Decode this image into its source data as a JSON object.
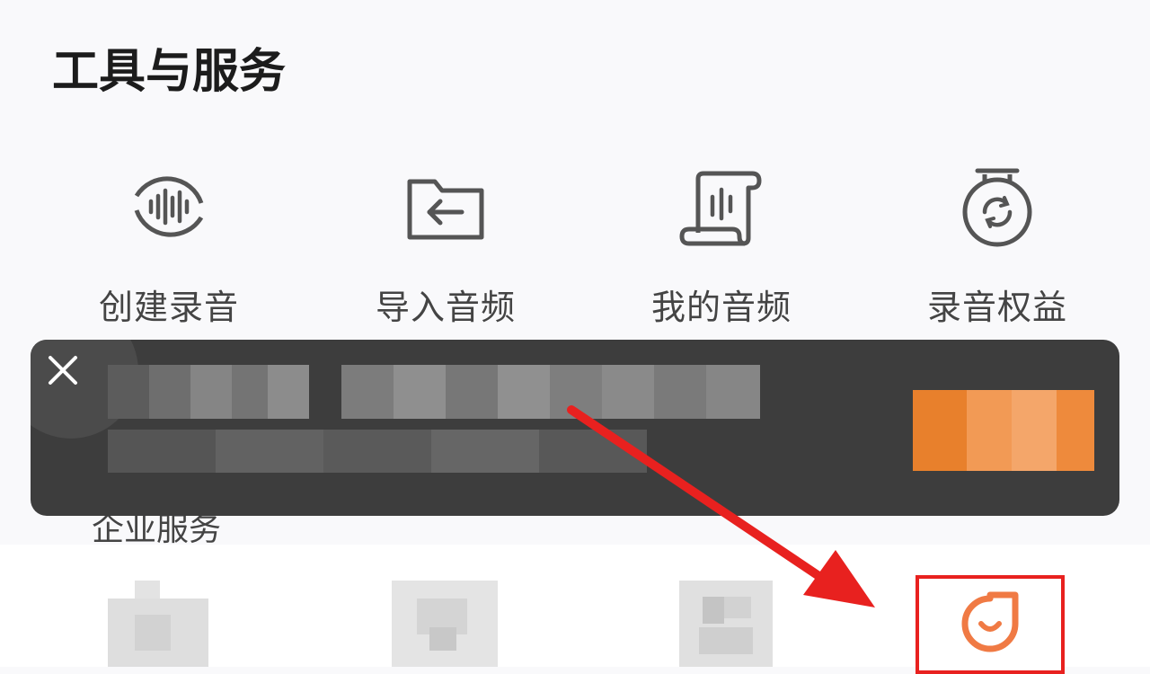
{
  "section": {
    "title": "工具与服务"
  },
  "tools": [
    {
      "label": "创建录音",
      "icon": "waveform-circle-icon"
    },
    {
      "label": "导入音频",
      "icon": "folder-import-icon"
    },
    {
      "label": "我的音频",
      "icon": "audio-scroll-icon"
    },
    {
      "label": "录音权益",
      "icon": "timer-refresh-icon"
    }
  ],
  "banner": {
    "close_icon": "close-icon",
    "content": "pixelated/obscured promotional content",
    "accent": "#f28a2e",
    "background": "#3d3d3d"
  },
  "enterprise": {
    "title": "企业服务"
  },
  "enterprise_apps": [
    {
      "icon": "blurred-app-icon"
    },
    {
      "icon": "blurred-app-icon"
    },
    {
      "icon": "blurred-app-icon"
    },
    {
      "icon": "orange-drop-smile-icon",
      "highlighted": true
    }
  ],
  "annotation": {
    "arrow_color": "#e8211f",
    "highlight_color": "#e8211f"
  }
}
